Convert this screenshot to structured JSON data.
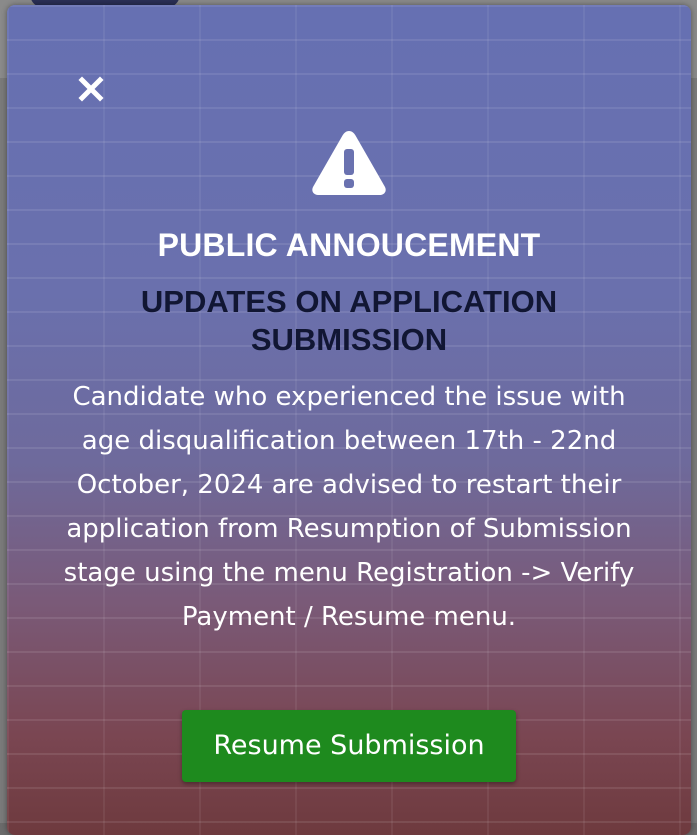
{
  "modal": {
    "close_icon": "close-icon",
    "warning_icon": "warning-triangle-icon",
    "heading": "PUBLIC ANNOUCEMENT",
    "subheading": "UPDATES ON APPLICATION SUBMISSION",
    "message": "Candidate who experienced the issue with age disqualification between 17th - 22nd October, 2024 are advised to restart their application from Resumption of Submission stage using the menu Registration -> Verify Payment / Resume menu.",
    "button_label": "Resume Submission"
  },
  "colors": {
    "button": "#1e8a1e",
    "heading": "#ffffff",
    "subheading": "#111633",
    "modal_top": "#6670b2",
    "modal_bottom": "#6e3a3e"
  }
}
